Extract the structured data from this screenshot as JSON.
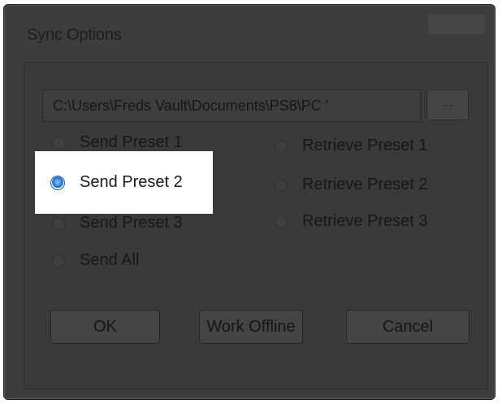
{
  "window": {
    "title": "Sync Options"
  },
  "path": {
    "value": "C:\\Users\\Freds Vault\\Documents\\PS8\\PC '"
  },
  "browse_label": "...",
  "send_options": [
    {
      "label": "Send Preset 1",
      "selected": false
    },
    {
      "label": "Send Preset 2",
      "selected": true
    },
    {
      "label": "Send Preset 3",
      "selected": false
    },
    {
      "label": "Send All",
      "selected": false
    }
  ],
  "retrieve_options": [
    {
      "label": "Retrieve Preset 1",
      "selected": false
    },
    {
      "label": "Retrieve Preset 2",
      "selected": false
    },
    {
      "label": "Retrieve Preset 3",
      "selected": false
    }
  ],
  "buttons": {
    "ok": "OK",
    "work_offline": "Work Offline",
    "cancel": "Cancel"
  },
  "colors": {
    "dim_overlay": "#3d3d3d",
    "highlight": "#ffffff",
    "radio_selected": "#3f8ee6"
  }
}
